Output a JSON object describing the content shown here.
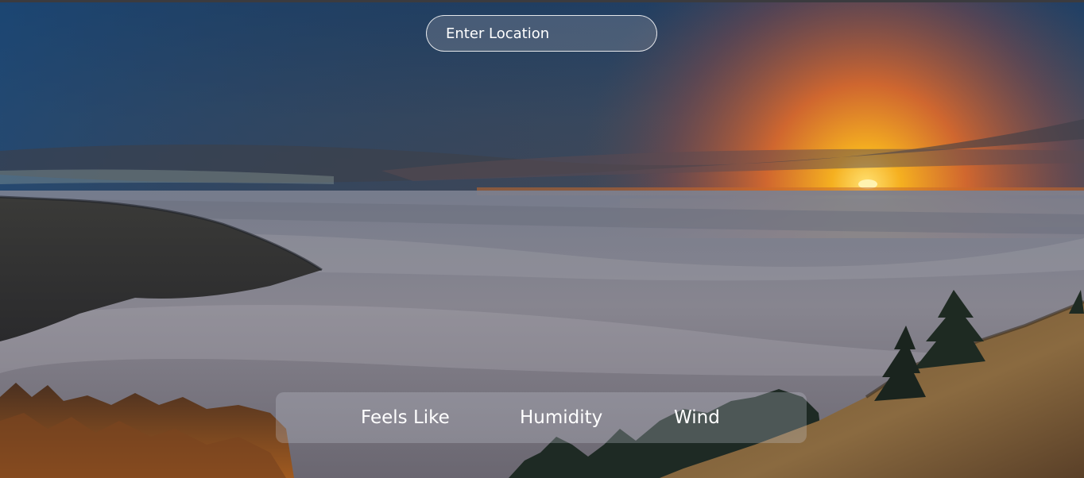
{
  "search": {
    "placeholder": "Enter Location"
  },
  "stats": {
    "feels_like_label": "Feels Like",
    "humidity_label": "Humidity",
    "wind_label": "Wind"
  },
  "background": {
    "scene": "sunset-over-fog-landscape",
    "colors": {
      "sky_top": "#20426a",
      "sky_mid": "#4a4b57",
      "sunset": "#f0a020",
      "fog": "#8e8e98"
    }
  }
}
